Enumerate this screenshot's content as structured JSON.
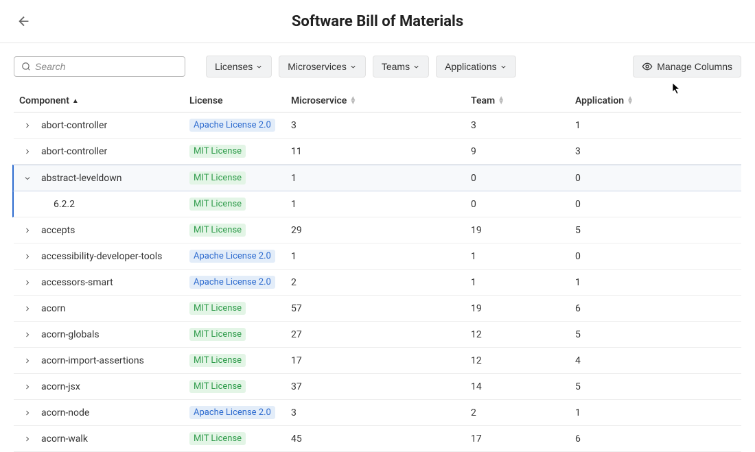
{
  "header": {
    "title": "Software Bill of Materials"
  },
  "toolbar": {
    "search_placeholder": "Search",
    "filters": {
      "licenses": "Licenses",
      "microservices": "Microservices",
      "teams": "Teams",
      "applications": "Applications"
    },
    "manage_columns": "Manage Columns"
  },
  "columns": {
    "component": "Component",
    "license": "License",
    "microservice": "Microservice",
    "team": "Team",
    "application": "Application"
  },
  "licenses": {
    "apache": "Apache License 2.0",
    "mit": "MIT License"
  },
  "rows": [
    {
      "expanded": false,
      "name": "abort-controller",
      "license": "apache",
      "microservice": "3",
      "team": "3",
      "application": "1"
    },
    {
      "expanded": false,
      "name": "abort-controller",
      "license": "mit",
      "microservice": "11",
      "team": "9",
      "application": "3"
    },
    {
      "expanded": true,
      "name": "abstract-leveldown",
      "license": "mit",
      "microservice": "1",
      "team": "0",
      "application": "0"
    },
    {
      "child": true,
      "name": "6.2.2",
      "license": "mit",
      "microservice": "1",
      "team": "0",
      "application": "0"
    },
    {
      "expanded": false,
      "name": "accepts",
      "license": "mit",
      "microservice": "29",
      "team": "19",
      "application": "5"
    },
    {
      "expanded": false,
      "name": "accessibility-developer-tools",
      "license": "apache",
      "microservice": "1",
      "team": "1",
      "application": "0"
    },
    {
      "expanded": false,
      "name": "accessors-smart",
      "license": "apache",
      "microservice": "2",
      "team": "1",
      "application": "1"
    },
    {
      "expanded": false,
      "name": "acorn",
      "license": "mit",
      "microservice": "57",
      "team": "19",
      "application": "6"
    },
    {
      "expanded": false,
      "name": "acorn-globals",
      "license": "mit",
      "microservice": "27",
      "team": "12",
      "application": "5"
    },
    {
      "expanded": false,
      "name": "acorn-import-assertions",
      "license": "mit",
      "microservice": "17",
      "team": "12",
      "application": "4"
    },
    {
      "expanded": false,
      "name": "acorn-jsx",
      "license": "mit",
      "microservice": "37",
      "team": "14",
      "application": "5"
    },
    {
      "expanded": false,
      "name": "acorn-node",
      "license": "apache",
      "microservice": "3",
      "team": "2",
      "application": "1"
    },
    {
      "expanded": false,
      "name": "acorn-walk",
      "license": "mit",
      "microservice": "45",
      "team": "17",
      "application": "6"
    }
  ]
}
